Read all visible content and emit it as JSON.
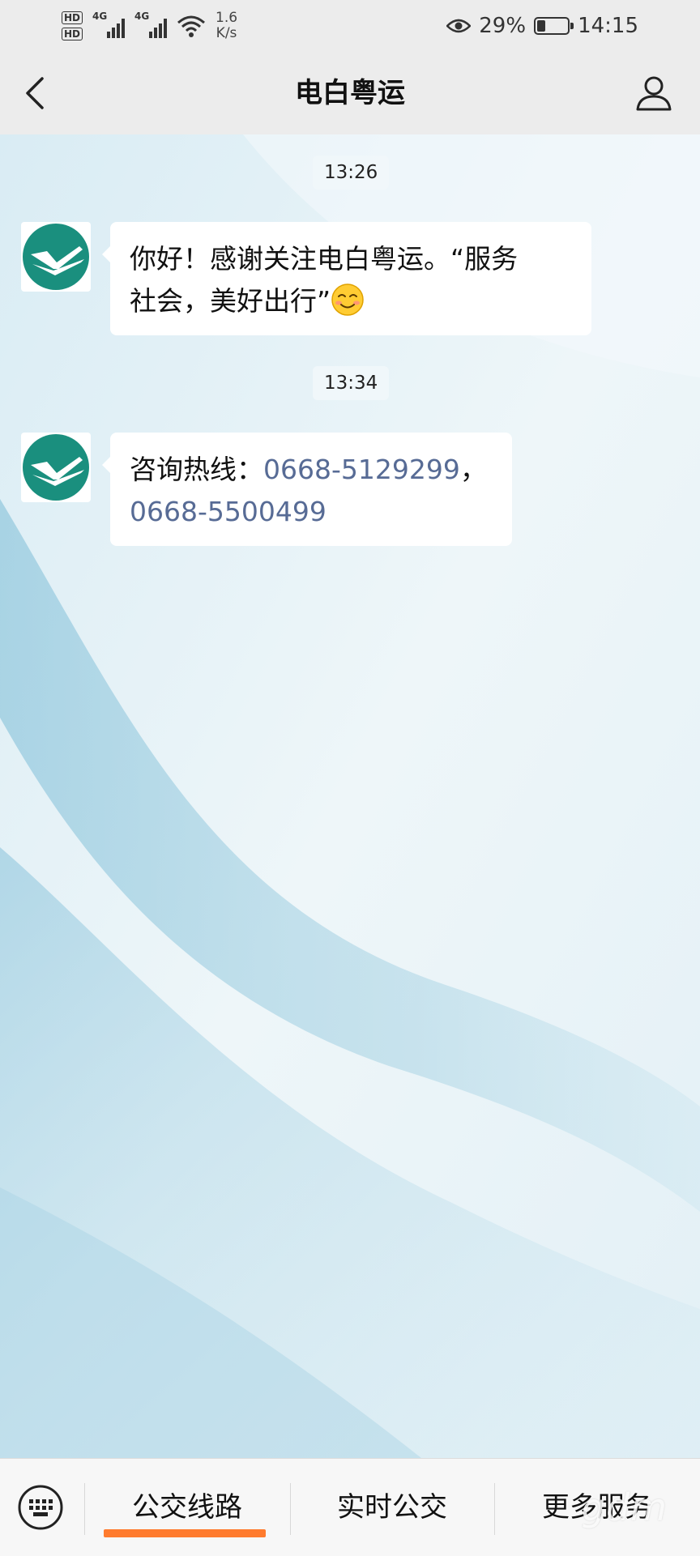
{
  "status_bar": {
    "hd1": "HD",
    "hd2": "HD",
    "signal1_label": "4G",
    "signal2_label": "4G",
    "net_speed_value": "1.6",
    "net_speed_unit": "K/s",
    "eye_icon": "eye-icon",
    "battery_percent": "29%",
    "battery_level": 0.29,
    "time": "14:15"
  },
  "nav": {
    "back_icon": "chevron-left-icon",
    "title": "电白粤运",
    "profile_icon": "person-icon"
  },
  "messages": [
    {
      "timestamp": "13:26",
      "text": "你好！感谢关注电白粤运。“服务社会，美好出行”",
      "line1": "你好！感谢关注电白粤运。“服务",
      "line2": "社会，美好出行”",
      "emoji": "smiling-face-icon"
    },
    {
      "timestamp": "13:34",
      "prefix": "咨询热线：",
      "phone1": "0668-5129299",
      "separator": "，",
      "phone2": "0668-5500499"
    }
  ],
  "bottom_menu": {
    "keyboard_icon": "keyboard-icon",
    "items": [
      {
        "label": "公交线路"
      },
      {
        "label": "实时公交"
      },
      {
        "label": "更多服务"
      }
    ],
    "accent_color": "#ff7b2e"
  },
  "watermark": "gdm",
  "colors": {
    "link": "#576b95",
    "logo_green": "#1a8f7e"
  }
}
